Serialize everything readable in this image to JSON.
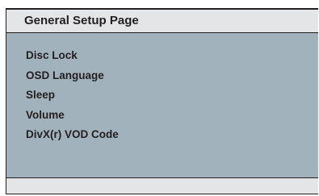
{
  "page": {
    "title": "General Setup Page"
  },
  "menu": {
    "items": [
      {
        "label": "Disc Lock"
      },
      {
        "label": "OSD Language"
      },
      {
        "label": "Sleep"
      },
      {
        "label": "Volume"
      },
      {
        "label": "DivX(r) VOD Code"
      }
    ]
  },
  "colors": {
    "header_bg": "#e4e5e6",
    "body_bg": "#a2b2bd",
    "footer_bg": "#e4e5e6",
    "text": "#231f20",
    "border": "#231f20"
  }
}
